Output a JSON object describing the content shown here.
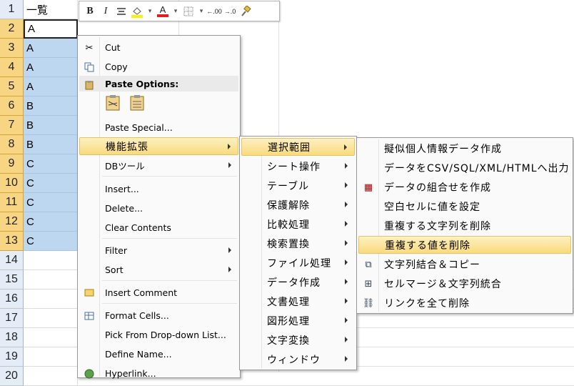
{
  "sheet": {
    "header_cell": "一覧",
    "rows": [
      {
        "num": "1",
        "value": "一覧"
      },
      {
        "num": "2",
        "value": "A"
      },
      {
        "num": "3",
        "value": "A"
      },
      {
        "num": "4",
        "value": "A"
      },
      {
        "num": "5",
        "value": "A"
      },
      {
        "num": "6",
        "value": "B"
      },
      {
        "num": "7",
        "value": "B"
      },
      {
        "num": "8",
        "value": "B"
      },
      {
        "num": "9",
        "value": "C"
      },
      {
        "num": "10",
        "value": "C"
      },
      {
        "num": "11",
        "value": "C"
      },
      {
        "num": "12",
        "value": "C"
      },
      {
        "num": "13",
        "value": "C"
      },
      {
        "num": "14",
        "value": ""
      },
      {
        "num": "15",
        "value": ""
      },
      {
        "num": "16",
        "value": ""
      },
      {
        "num": "17",
        "value": ""
      },
      {
        "num": "18",
        "value": ""
      },
      {
        "num": "19",
        "value": ""
      },
      {
        "num": "20",
        "value": ""
      }
    ]
  },
  "minibar": {
    "bold": "B",
    "italic": "I",
    "font_color_letter": "A",
    "dec_inc": ".00",
    "dec_dec": ".0"
  },
  "context_menu": {
    "cut": "Cut",
    "copy": "Copy",
    "paste_options": "Paste Options:",
    "paste_special": "Paste Special...",
    "kinou": "機能拡張",
    "db_tool": "DBツール",
    "insert": "Insert...",
    "delete": "Delete...",
    "clear_contents": "Clear Contents",
    "filter": "Filter",
    "sort": "Sort",
    "insert_comment": "Insert Comment",
    "format_cells": "Format Cells...",
    "pick_list": "Pick From Drop-down List...",
    "define_name": "Define Name...",
    "hyperlink": "Hyperlink..."
  },
  "submenu1": [
    "選択範囲",
    "シート操作",
    "テーブル",
    "保護解除",
    "比較処理",
    "検索置換",
    "ファイル処理",
    "データ作成",
    "文書処理",
    "図形処理",
    "文字変換",
    "ウィンドウ"
  ],
  "submenu2": [
    "擬似個人情報データ作成",
    "データをCSV/SQL/XML/HTMLへ出力",
    "データの組合せを作成",
    "空白セルに値を設定",
    "重複する文字列を削除",
    "重複する値を削除",
    "文字列結合＆コピー",
    "セルマージ＆文字列統合",
    "リンクを全て削除"
  ],
  "colors": {
    "selection": "#bdd7f1",
    "row_header_selected": "#f8d582",
    "menu_highlight": "#f9da7c",
    "font_color_red": "#e02020",
    "fill_yellow": "#ffef00"
  }
}
